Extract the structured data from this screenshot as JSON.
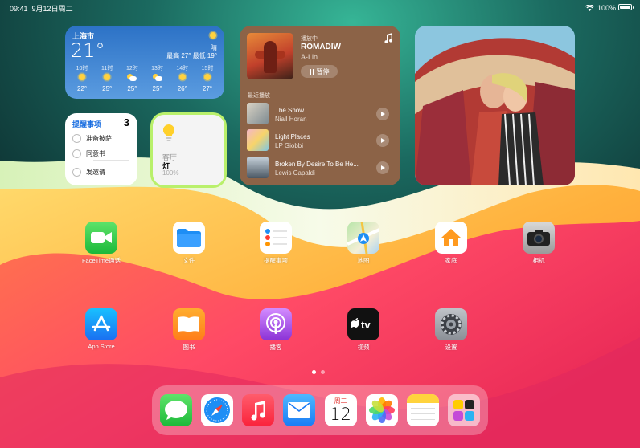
{
  "status_bar": {
    "time": "09:41",
    "date": "9月12日周二",
    "battery": "100%"
  },
  "weather": {
    "city": "上海市",
    "temp": "21°",
    "condition": "晴",
    "hilo": "最高 27° 最低 19°",
    "hours": [
      {
        "time": "10时",
        "temp": "22°",
        "icon": "sun-icon"
      },
      {
        "time": "11时",
        "temp": "25°",
        "icon": "sun-icon"
      },
      {
        "time": "12时",
        "temp": "25°",
        "icon": "partly-cloudy-icon"
      },
      {
        "time": "13时",
        "temp": "25°",
        "icon": "partly-cloudy-icon"
      },
      {
        "time": "14时",
        "temp": "26°",
        "icon": "sun-icon"
      },
      {
        "time": "15时",
        "temp": "27°",
        "icon": "sun-icon"
      }
    ]
  },
  "reminders": {
    "title": "提醒事项",
    "count": "3",
    "items": [
      "准备披萨",
      "同意书",
      "发邀请"
    ]
  },
  "home": {
    "room": "客厅",
    "device": "灯",
    "level": "100%"
  },
  "music": {
    "status": "播放中",
    "title": "ROMADIW",
    "artist": "A-Lin",
    "pause_label": "暂停",
    "recent_label": "最近播放",
    "recent": [
      {
        "title": "The Show",
        "artist": "Niall Horan"
      },
      {
        "title": "Light Places",
        "artist": "LP Giobbi"
      },
      {
        "title": "Broken By Desire To Be He...",
        "artist": "Lewis Capaldi"
      }
    ]
  },
  "apps": [
    {
      "label": "FaceTime通话",
      "icon": "facetime-icon"
    },
    {
      "label": "文件",
      "icon": "files-icon"
    },
    {
      "label": "提醒事项",
      "icon": "reminders-icon"
    },
    {
      "label": "地图",
      "icon": "maps-icon"
    },
    {
      "label": "家庭",
      "icon": "home-icon"
    },
    {
      "label": "相机",
      "icon": "camera-icon"
    },
    {
      "label": "App Store",
      "icon": "app-store-icon"
    },
    {
      "label": "图书",
      "icon": "books-icon"
    },
    {
      "label": "播客",
      "icon": "podcasts-icon"
    },
    {
      "label": "视频",
      "icon": "apple-tv-icon"
    },
    {
      "label": "设置",
      "icon": "settings-icon"
    }
  ],
  "dock": {
    "calendar_day": "周二",
    "calendar_date": "12",
    "apps": [
      "messages-icon",
      "safari-icon",
      "music-icon",
      "mail-icon",
      "calendar-icon",
      "photos-icon",
      "notes-icon",
      "app-library-icon"
    ]
  },
  "page_dots": {
    "count": 2,
    "current": 1
  }
}
